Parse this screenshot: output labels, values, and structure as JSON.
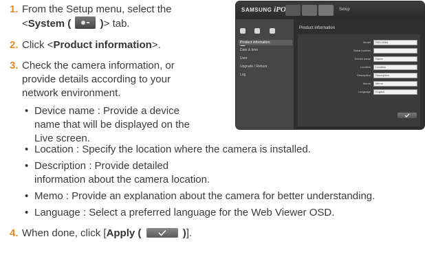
{
  "steps": [
    {
      "num": "1.",
      "line1": "From the Setup menu, select the",
      "line2_before": "<",
      "line2_bold": "System (",
      "line2_bold_end": ")",
      "line2_after": "> tab."
    },
    {
      "num": "2.",
      "before": "Click <",
      "bold": "Product information",
      "after": ">."
    },
    {
      "num": "3.",
      "line1": "Check the camera information, or",
      "line2": "provide details according to your",
      "line3": "network environment."
    },
    {
      "num": "4.",
      "before": "When done, click [",
      "bold": "Apply (",
      "bold_end": ")",
      "after": "]."
    }
  ],
  "bullets": [
    {
      "lines": [
        "Device name : Provide a device",
        "name that will be displayed on the",
        "Live screen."
      ]
    },
    {
      "lines": [
        "Location : Specify the location where the camera is installed."
      ]
    },
    {
      "lines": [
        "Description : Provide detailed",
        "information about the camera location."
      ]
    },
    {
      "lines": [
        "Memo : Provide an explanation about the camera for better understanding."
      ]
    },
    {
      "lines": [
        "Language : Select a preferred language for the Web Viewer OSD."
      ]
    }
  ],
  "icons": {
    "system_tab": "gear-icon",
    "apply": "checkmark-icon"
  },
  "colors": {
    "step_number": "#e8891f"
  },
  "screenshot": {
    "logo_samsung": "SAMSUNG",
    "logo_ipolis": "iPOLIS",
    "setup_label": "Setup",
    "main_title": "Product information",
    "sidebar": [
      "Product information",
      "Date & time",
      "User",
      "Upgrade / Reboot",
      "Log"
    ],
    "form": [
      {
        "label": "Model",
        "value": "SNV-5084"
      },
      {
        "label": "Serial number",
        "value": ""
      },
      {
        "label": "Device name",
        "value": "Name"
      },
      {
        "label": "Location",
        "value": "Location"
      },
      {
        "label": "Description",
        "value": "Description"
      },
      {
        "label": "Memo",
        "value": "Memo"
      },
      {
        "label": "Language",
        "value": "English"
      }
    ]
  }
}
